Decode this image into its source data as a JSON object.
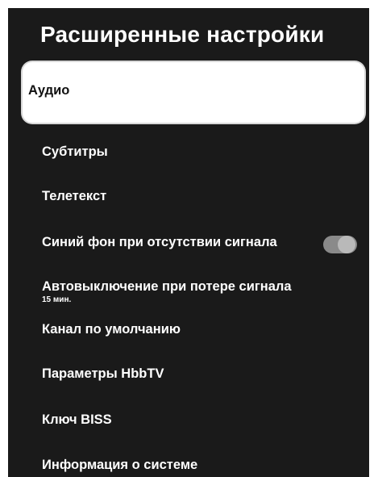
{
  "header": {
    "title": "Расширенные настройки"
  },
  "menu": {
    "items": [
      {
        "label": "Аудио"
      },
      {
        "label": "Субтитры"
      },
      {
        "label": "Телетекст"
      },
      {
        "label": "Синий фон при отсутствии сигнала"
      },
      {
        "label": "Автовыключение при потере сигнала",
        "value": "15 мин."
      },
      {
        "label": "Канал по умолчанию"
      },
      {
        "label": "Параметры HbbTV"
      },
      {
        "label": "Ключ BISS"
      },
      {
        "label": "Информация о системе"
      }
    ]
  },
  "toggle_blue_background": {
    "state": "on",
    "icon": "toggle-switch-icon"
  },
  "colors": {
    "background": "#1a1a1a",
    "selected": "#ffffff",
    "text": "#ffffff"
  }
}
